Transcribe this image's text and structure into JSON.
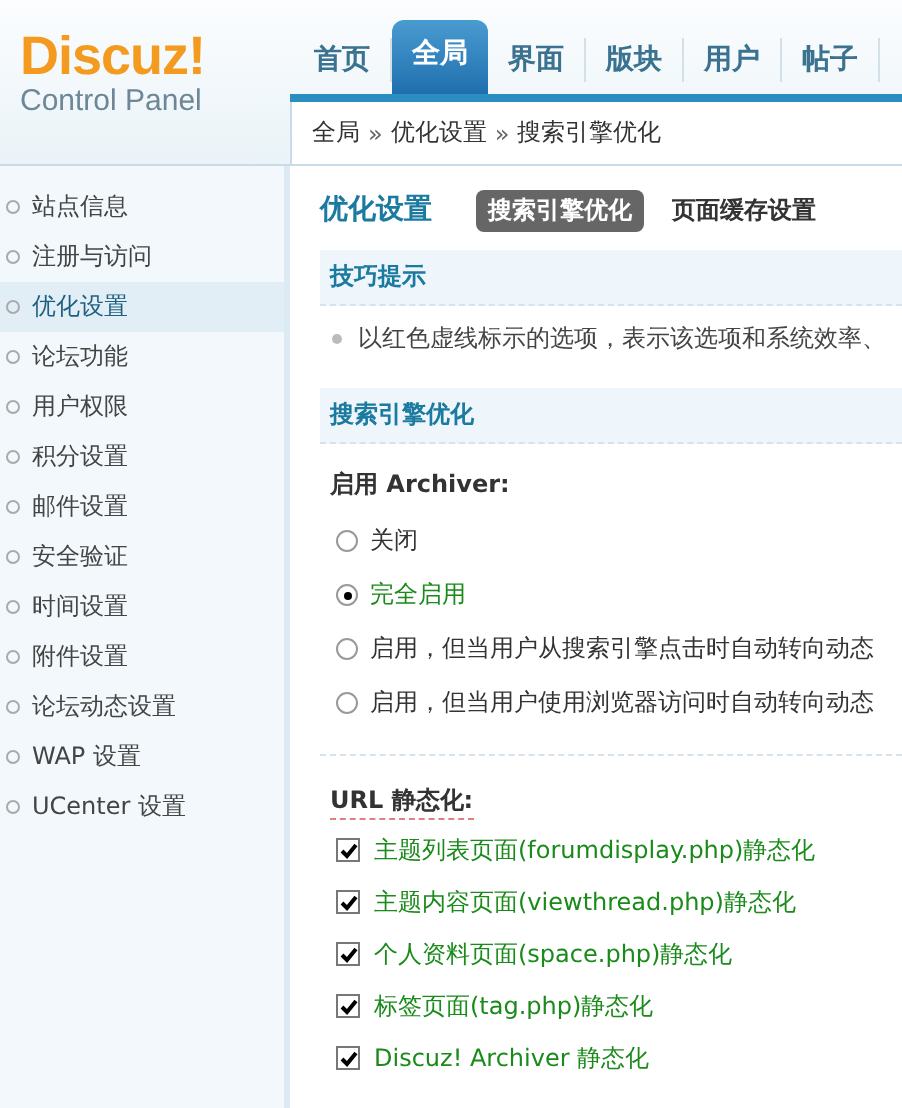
{
  "logo": {
    "name": "Discuz!",
    "subtitle": "Control Panel"
  },
  "nav": [
    {
      "label": "首页",
      "selected": false
    },
    {
      "label": "全局",
      "selected": true
    },
    {
      "label": "界面",
      "selected": false
    },
    {
      "label": "版块",
      "selected": false
    },
    {
      "label": "用户",
      "selected": false
    },
    {
      "label": "帖子",
      "selected": false
    }
  ],
  "breadcrumb": [
    "全局",
    "优化设置",
    "搜索引擎优化"
  ],
  "breadcrumb_separator": "»",
  "sidebar": {
    "items": [
      {
        "label": "站点信息",
        "selected": false
      },
      {
        "label": "注册与访问",
        "selected": false
      },
      {
        "label": "优化设置",
        "selected": true
      },
      {
        "label": "论坛功能",
        "selected": false
      },
      {
        "label": "用户权限",
        "selected": false
      },
      {
        "label": "积分设置",
        "selected": false
      },
      {
        "label": "邮件设置",
        "selected": false
      },
      {
        "label": "安全验证",
        "selected": false
      },
      {
        "label": "时间设置",
        "selected": false
      },
      {
        "label": "附件设置",
        "selected": false
      },
      {
        "label": "论坛动态设置",
        "selected": false
      },
      {
        "label": "WAP 设置",
        "selected": false
      },
      {
        "label": "UCenter 设置",
        "selected": false
      }
    ]
  },
  "page_title": "优化设置",
  "subtabs": [
    {
      "label": "搜索引擎优化",
      "selected": true
    },
    {
      "label": "页面缓存设置",
      "selected": false
    }
  ],
  "tips": {
    "title": "技巧提示",
    "items": [
      "以红色虚线标示的选项，表示该选项和系统效率、"
    ]
  },
  "section_title": "搜索引擎优化",
  "archiver": {
    "label": "启用 Archiver:",
    "options": [
      {
        "label": "关闭",
        "selected": false
      },
      {
        "label": "完全启用",
        "selected": true
      },
      {
        "label": "启用，但当用户从搜索引擎点击时自动转向动态",
        "selected": false
      },
      {
        "label": "启用，但当用户使用浏览器访问时自动转向动态",
        "selected": false
      }
    ]
  },
  "url_static": {
    "label": "URL 静态化:",
    "options": [
      {
        "label": "主题列表页面(forumdisplay.php)静态化",
        "checked": true
      },
      {
        "label": "主题内容页面(viewthread.php)静态化",
        "checked": true
      },
      {
        "label": "个人资料页面(space.php)静态化",
        "checked": true
      },
      {
        "label": "标签页面(tag.php)静态化",
        "checked": true
      },
      {
        "label": "Discuz! Archiver 静态化",
        "checked": true
      }
    ]
  }
}
